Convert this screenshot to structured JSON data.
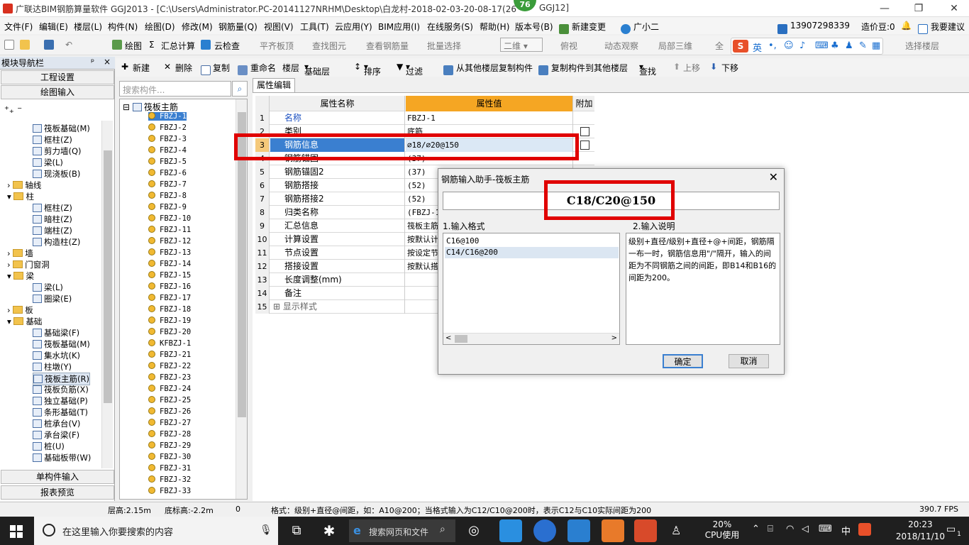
{
  "window": {
    "title": "广联达BIM钢筋算量软件 GGJ2013 - [C:\\Users\\Administrator.PC-20141127NRHM\\Desktop\\白龙村-2018-02-03-20-08-17(26",
    "title_tail": "GGJ12]",
    "badge": "76",
    "min": "—",
    "max": "❐",
    "close": "✕"
  },
  "menu": [
    "文件(F)",
    "编辑(E)",
    "楼层(L)",
    "构件(N)",
    "绘图(D)",
    "修改(M)",
    "钢筋量(Q)",
    "视图(V)",
    "工具(T)",
    "云应用(Y)",
    "BIM应用(I)",
    "在线服务(S)",
    "帮助(H)",
    "版本号(B)",
    "新建变更",
    "广小二"
  ],
  "account": {
    "phone": "13907298339",
    "price": "造价豆:0",
    "help": "我要建议"
  },
  "toolbar1": {
    "draw": "绘图",
    "sum": "汇总计算",
    "cloud": "云检查",
    "flat": "平齐板顶",
    "find": "查找图元",
    "view_rebar": "查看钢筋量",
    "batch": "批量选择",
    "view_mode": "二维",
    "top_view": "俯视",
    "dynamic": "动态观察",
    "local3d": "局部三维",
    "full": "全",
    "select_floor": "选择楼层"
  },
  "sogou": {
    "lang": "英"
  },
  "nav": {
    "header": "模块导航栏",
    "pin": "ᵖ",
    "close": "×",
    "project_settings": "工程设置",
    "drawing_input": "绘图输入",
    "tree": [
      {
        "label": "筏板基础(M)",
        "level": 3
      },
      {
        "label": "框柱(Z)",
        "level": 3
      },
      {
        "label": "剪力墙(Q)",
        "level": 3
      },
      {
        "label": "梁(L)",
        "level": 3
      },
      {
        "label": "现浇板(B)",
        "level": 3
      },
      {
        "label": "轴线",
        "level": 1
      },
      {
        "label": "柱",
        "level": 1
      },
      {
        "label": "框柱(Z)",
        "level": 2
      },
      {
        "label": "暗柱(Z)",
        "level": 2
      },
      {
        "label": "端柱(Z)",
        "level": 2
      },
      {
        "label": "构造柱(Z)",
        "level": 2
      },
      {
        "label": "墙",
        "level": 1
      },
      {
        "label": "门窗洞",
        "level": 1
      },
      {
        "label": "梁",
        "level": 1
      },
      {
        "label": "梁(L)",
        "level": 2
      },
      {
        "label": "圈梁(E)",
        "level": 2
      },
      {
        "label": "板",
        "level": 1
      },
      {
        "label": "基础",
        "level": 1
      },
      {
        "label": "基础梁(F)",
        "level": 2
      },
      {
        "label": "筏板基础(M)",
        "level": 2
      },
      {
        "label": "集水坑(K)",
        "level": 2
      },
      {
        "label": "柱墩(Y)",
        "level": 2
      },
      {
        "label": "筏板主筋(R)",
        "level": 2
      },
      {
        "label": "筏板负筋(X)",
        "level": 2
      },
      {
        "label": "独立基础(P)",
        "level": 2
      },
      {
        "label": "条形基础(T)",
        "level": 2
      },
      {
        "label": "桩承台(V)",
        "level": 2
      },
      {
        "label": "承台梁(F)",
        "level": 2
      },
      {
        "label": "桩(U)",
        "level": 2
      },
      {
        "label": "基础板带(W)",
        "level": 2
      }
    ],
    "single_input": "单构件输入",
    "report_preview": "报表预览"
  },
  "toolbar2": {
    "new": "新建",
    "delete": "删除",
    "copy": "复制",
    "rename": "重命名",
    "floor": "楼层",
    "floor_value": "基础层",
    "sort": "排序",
    "filter": "过滤",
    "copy_from": "从其他楼层复制构件",
    "copy_to": "复制构件到其他楼层",
    "find": "查找",
    "up": "上移",
    "down": "下移"
  },
  "comp_search": {
    "placeholder": "搜索构件..."
  },
  "comp_tree": {
    "root": "筏板主筋",
    "items": [
      "FBZJ-1",
      "FBZJ-2",
      "FBZJ-3",
      "FBZJ-4",
      "FBZJ-5",
      "FBZJ-6",
      "FBZJ-7",
      "FBZJ-8",
      "FBZJ-9",
      "FBZJ-10",
      "FBZJ-11",
      "FBZJ-12",
      "FBZJ-13",
      "FBZJ-14",
      "FBZJ-15",
      "FBZJ-16",
      "FBZJ-17",
      "FBZJ-18",
      "FBZJ-19",
      "FBZJ-20",
      "KFBZJ-1",
      "FBZJ-21",
      "FBZJ-22",
      "FBZJ-23",
      "FBZJ-24",
      "FBZJ-25",
      "FBZJ-26",
      "FBZJ-27",
      "FBZJ-28",
      "FBZJ-29",
      "FBZJ-30",
      "FBZJ-31",
      "FBZJ-32",
      "FBZJ-33"
    ]
  },
  "prop": {
    "tab": "属性编辑",
    "col_name": "属性名称",
    "col_value": "属性值",
    "col_extra": "附加",
    "rows": [
      {
        "n": "1",
        "name": "名称",
        "value": "FBZJ-1",
        "check": false
      },
      {
        "n": "2",
        "name": "类别",
        "value": "底筋",
        "check": true
      },
      {
        "n": "3",
        "name": "钢筋信息",
        "value": "⌀18/⌀20@150",
        "check": true
      },
      {
        "n": "4",
        "name": "钢筋锚固",
        "value": "(37)",
        "check": false
      },
      {
        "n": "5",
        "name": "钢筋锚固2",
        "value": "(37)",
        "check": false
      },
      {
        "n": "6",
        "name": "钢筋搭接",
        "value": "(52)",
        "check": false
      },
      {
        "n": "7",
        "name": "钢筋搭接2",
        "value": "(52)",
        "check": false
      },
      {
        "n": "8",
        "name": "归类名称",
        "value": "(FBZJ-1",
        "check": false
      },
      {
        "n": "9",
        "name": "汇总信息",
        "value": "筏板主筋",
        "check": false
      },
      {
        "n": "10",
        "name": "计算设置",
        "value": "按默认计",
        "check": false
      },
      {
        "n": "11",
        "name": "节点设置",
        "value": "按设定节",
        "check": false
      },
      {
        "n": "12",
        "name": "搭接设置",
        "value": "按默认搭",
        "check": false
      },
      {
        "n": "13",
        "name": "长度调整(mm)",
        "value": "",
        "check": false
      },
      {
        "n": "14",
        "name": "备注",
        "value": "",
        "check": false
      },
      {
        "n": "15",
        "name": "显示样式",
        "value": "",
        "check": false
      }
    ]
  },
  "dialog": {
    "title": "钢筋输入助手-筏板主筋",
    "close": "✕",
    "input": "C18/C20@150",
    "format_label": "1.输入格式",
    "desc_label": "2.输入说明",
    "formats": [
      "C16@100",
      "C14/C16@200"
    ],
    "desc": "级别+直径/级别+直径+@+间距，钢筋隔一布一时，钢筋信息用\"/\"隔开，输入的间距为不同钢筋之间的间距，即B14和B16的间距为200。",
    "ok": "确定",
    "cancel": "取消"
  },
  "status": {
    "floor_height": "层高:2.15m",
    "bottom": "底标高:-2.2m",
    "zero": "0",
    "hint": "格式：级别+直径@间距，如：A10@200；当格式输入为C12/C10@200时，表示C12与C10实际间距为200",
    "fps": "390.7 FPS"
  },
  "taskbar": {
    "search": "在这里输入你要搜索的内容",
    "browser": "搜索网页和文件",
    "cpu_pct": "20%",
    "cpu_label": "CPU使用",
    "ime": "中",
    "time": "20:23",
    "date": "2018/11/10",
    "notif": "1"
  },
  "colors": {
    "accent": "#3a7fd0",
    "red_highlight": "#e00000",
    "value_header": "#f5a623"
  }
}
